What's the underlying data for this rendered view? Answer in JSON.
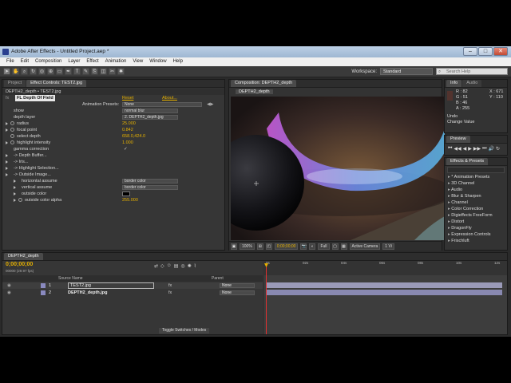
{
  "window": {
    "title": "Adobe After Effects - Untitled Project.aep *",
    "buttons": [
      "–",
      "□",
      "✕"
    ]
  },
  "menu": [
    "File",
    "Edit",
    "Composition",
    "Layer",
    "Effect",
    "Animation",
    "View",
    "Window",
    "Help"
  ],
  "toolbar": {
    "workspace_label": "Workspace:",
    "workspace_value": "Standard",
    "search_placeholder": "Search Help"
  },
  "effect_controls": {
    "tabs": [
      "Project",
      "Effect Controls: TEST2.jpg"
    ],
    "breadcrumb": "DEPTH2_depth • TEST2.jpg",
    "effect_name": "FL Depth Of Field",
    "reset": "Reset",
    "about": "About...",
    "animation_presets_label": "Animation Presets:",
    "animation_presets_value": "None",
    "rows": [
      {
        "label": "show",
        "type": "dropdown",
        "value": "normal blur"
      },
      {
        "label": "depth layer",
        "type": "dropdown",
        "value": "2. DEPTH2_depth.jpg"
      },
      {
        "label": "radius",
        "type": "value",
        "value": "25.000"
      },
      {
        "label": "focal point",
        "type": "value",
        "value": "0.842"
      },
      {
        "label": "select depth",
        "type": "value",
        "value": "658.0,424.0"
      },
      {
        "label": "highlight intensity",
        "type": "value",
        "value": "1.000"
      },
      {
        "label": "gamma correction",
        "type": "check",
        "value": "✓"
      },
      {
        "label": "-> Depth Buffer...",
        "type": "group",
        "value": ""
      },
      {
        "label": "-> Iris...",
        "type": "group",
        "value": ""
      },
      {
        "label": "-> Highlight Selection...",
        "type": "group",
        "value": ""
      },
      {
        "label": "-> Outside Image...",
        "type": "group-open",
        "value": ""
      },
      {
        "label": "horizontal assume",
        "type": "dropdown",
        "value": "border color"
      },
      {
        "label": "vertical assume",
        "type": "dropdown",
        "value": "border color"
      },
      {
        "label": "outside color",
        "type": "color",
        "value": ""
      },
      {
        "label": "outside color alpha",
        "type": "value",
        "value": "255.000"
      }
    ]
  },
  "composition": {
    "tab": "Composition: DEPTH2_depth",
    "subtab": "DEPTH2_depth",
    "zoom": "100%",
    "timecode": "0;00;00;00",
    "resolution": "Full",
    "camera": "Active Camera",
    "views": "1 Vi"
  },
  "info": {
    "tabs": [
      "Info",
      "Audio"
    ],
    "r": "R : 82",
    "g": "G : 51",
    "b": "B : 46",
    "a": "A : 255",
    "x": "X : 671",
    "y": "Y : 110",
    "undo": "Undo",
    "change_value": "Change Value"
  },
  "preview": {
    "tab": "Preview",
    "controls": [
      "⏮",
      "◀◀",
      "◀",
      "▶",
      "▶▶",
      "⏭",
      "🔊",
      "↻"
    ]
  },
  "effects_presets": {
    "tab": "Effects & Presets",
    "items": [
      "* Animation Presets",
      "3D Channel",
      "Audio",
      "Blur & Sharpen",
      "Channel",
      "Color Correction",
      "Digieffects FreeForm",
      "Distort",
      "DragonFly",
      "Expression Controls",
      "Frischluft"
    ]
  },
  "timeline": {
    "tab": "DEPTH2_depth",
    "timecode": "0;00;00;00",
    "frame_info": "00000 (29.97 fps)",
    "col_source_name": "Source Name",
    "col_parent": "Parent",
    "layers": [
      {
        "num": "1",
        "name": "TEST2.jpg",
        "parent": "None"
      },
      {
        "num": "2",
        "name": "DEPTH2_depth.jpg",
        "parent": "None"
      }
    ],
    "ruler": [
      "0s",
      "02s",
      "04s",
      "06s",
      "08s",
      "10s",
      "12s"
    ],
    "toggle_label": "Toggle Switches / Modes"
  },
  "colors": {
    "accent_value": "#e5b000",
    "track_color": "#9a9ab8"
  }
}
